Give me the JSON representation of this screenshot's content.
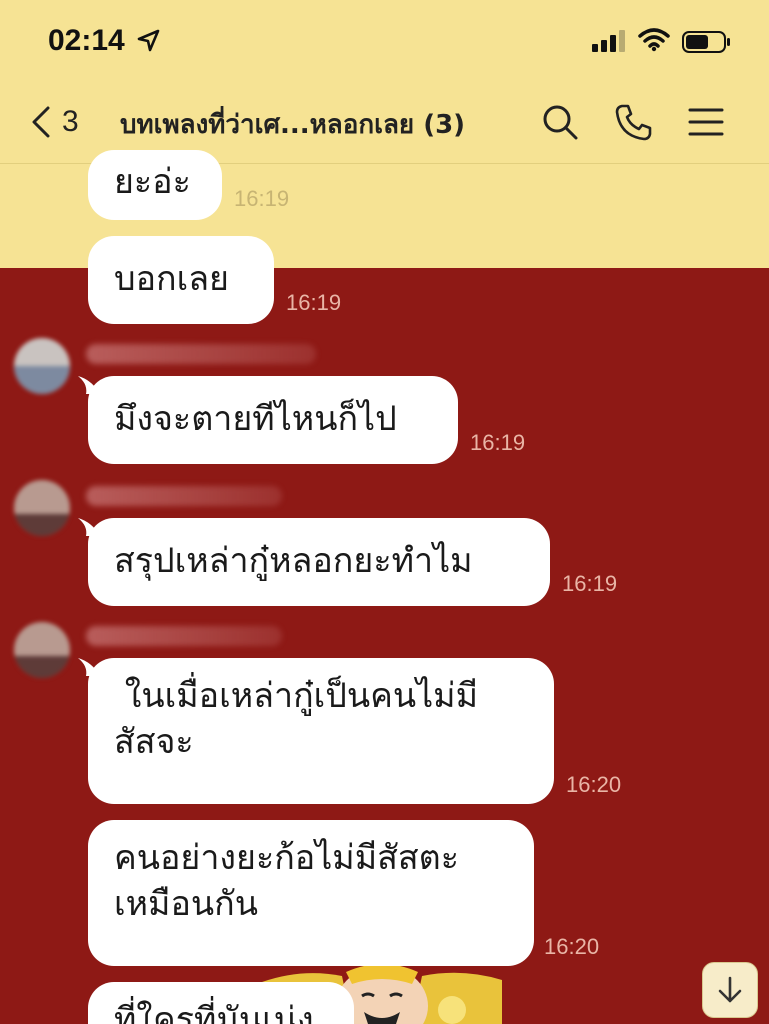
{
  "status_bar": {
    "time": "02:14",
    "icons": [
      "location-arrow-icon",
      "signal-icon",
      "wifi-icon",
      "battery-icon"
    ]
  },
  "header": {
    "back_count": "3",
    "title": "บทเพลงที่ว่าเศ...หลอกเลย (3)",
    "icons": [
      "search-icon",
      "phone-icon",
      "menu-icon"
    ]
  },
  "messages": [
    {
      "text": "ยะอ่ะ",
      "time": "16:19"
    },
    {
      "text": "บอกเลย",
      "time": "16:19"
    },
    {
      "text": "มึงจะตายทีไหนก็ไป",
      "time": "16:19"
    },
    {
      "text": "สรุปเหล่ากู๋หลอกยะทำไม",
      "time": "16:19"
    },
    {
      "text_line1": " ในเมื่อเหล่ากู๋เป็นคนไม่มี",
      "text_line2": "สัสจะ",
      "time": "16:20"
    },
    {
      "text_line1": "คนอย่างยะก้อไม่มีสัสตะ",
      "text_line2": "เหมือนกัน",
      "time": "16:20"
    },
    {
      "text": "ที่ใครที่มันเน่ง"
    }
  ],
  "colors": {
    "header_bg": "#f6e394",
    "chat_bg_red": "#8e1915",
    "bubble": "#ffffff"
  },
  "scroll_button_icon": "arrow-down-icon"
}
